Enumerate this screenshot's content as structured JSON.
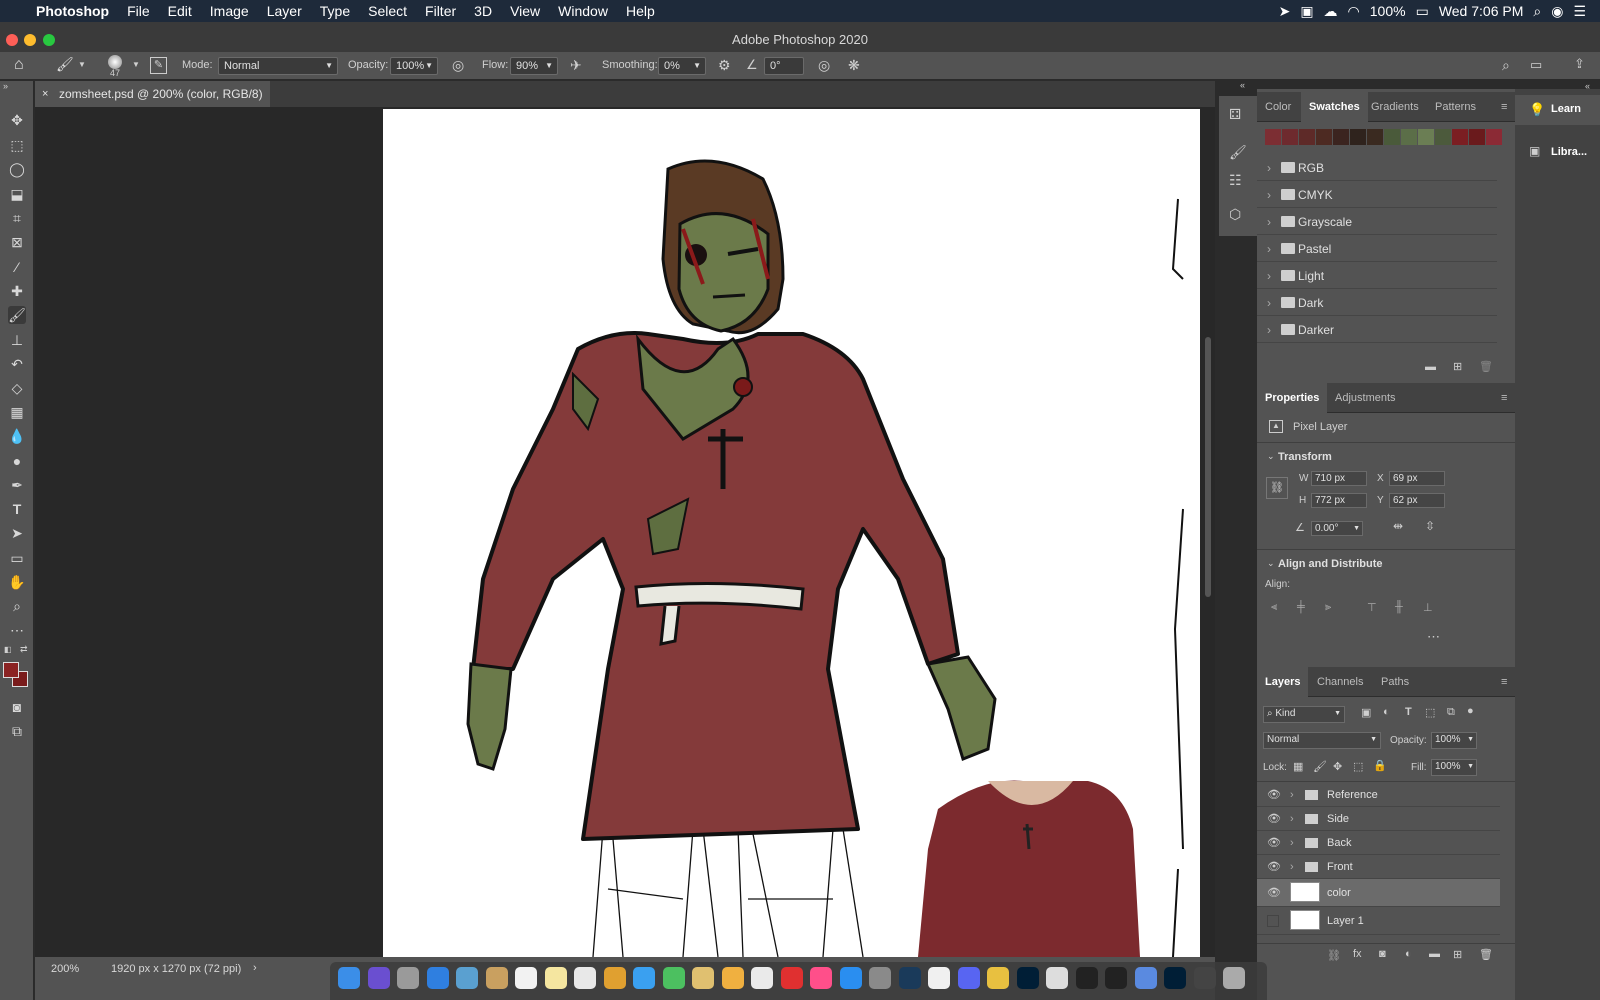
{
  "menubar": {
    "app_name": "Photoshop",
    "items": [
      "File",
      "Edit",
      "Image",
      "Layer",
      "Type",
      "Select",
      "Filter",
      "3D",
      "View",
      "Window",
      "Help"
    ],
    "battery": "100%",
    "clock": "Wed 7:06 PM"
  },
  "window": {
    "title": "Adobe Photoshop 2020"
  },
  "options": {
    "brush_size": "47",
    "mode_label": "Mode:",
    "mode_value": "Normal",
    "opacity_label": "Opacity:",
    "opacity_value": "100%",
    "flow_label": "Flow:",
    "flow_value": "90%",
    "smoothing_label": "Smoothing:",
    "smoothing_value": "0%",
    "angle_value": "0°"
  },
  "document": {
    "tab_title": "zomsheet.psd @ 200% (color, RGB/8) *",
    "zoom": "200%",
    "info": "1920 px x 1270 px (72 ppi)"
  },
  "colors": {
    "foreground": "#8b2323",
    "background": "#7a1c1c",
    "shirt": "#843a3a",
    "skin": "#6b7a4a",
    "hair": "#5a3a24"
  },
  "swatches_panel": {
    "tabs": [
      "Color",
      "Swatches",
      "Gradients",
      "Patterns"
    ],
    "active_tab": "Swatches",
    "recent_colors": [
      "#7c2e33",
      "#6e2a2e",
      "#5e2a28",
      "#4d2a22",
      "#3b241f",
      "#2f231d",
      "#3a2a20",
      "#4a5a3a",
      "#5b6e48",
      "#6b7e54",
      "#4c5a3c",
      "#7b1e22",
      "#6a1a1c",
      "#8b2a35"
    ],
    "groups": [
      "RGB",
      "CMYK",
      "Grayscale",
      "Pastel",
      "Light",
      "Dark",
      "Darker"
    ]
  },
  "properties_panel": {
    "tabs": [
      "Properties",
      "Adjustments"
    ],
    "active_tab": "Properties",
    "layer_type": "Pixel Layer",
    "transform_title": "Transform",
    "w_label": "W",
    "w_value": "710 px",
    "h_label": "H",
    "h_value": "772 px",
    "x_label": "X",
    "x_value": "69 px",
    "y_label": "Y",
    "y_value": "62 px",
    "angle_value": "0.00°",
    "align_title": "Align and Distribute",
    "align_label": "Align:"
  },
  "layers_panel": {
    "tabs": [
      "Layers",
      "Channels",
      "Paths"
    ],
    "active_tab": "Layers",
    "filter_kind": "Kind",
    "blend_mode": "Normal",
    "opacity_label": "Opacity:",
    "opacity_value": "100%",
    "lock_label": "Lock:",
    "fill_label": "Fill:",
    "fill_value": "100%",
    "layers": [
      {
        "name": "Reference",
        "type": "group",
        "visible": true
      },
      {
        "name": "Side",
        "type": "group",
        "visible": true
      },
      {
        "name": "Back",
        "type": "group",
        "visible": true
      },
      {
        "name": "Front",
        "type": "group",
        "visible": true
      },
      {
        "name": "color",
        "type": "pixel",
        "visible": true,
        "selected": true
      },
      {
        "name": "Layer 1",
        "type": "pixel",
        "visible": false
      }
    ]
  },
  "learn_panel": {
    "learn_label": "Learn",
    "libraries_label": "Libra..."
  }
}
